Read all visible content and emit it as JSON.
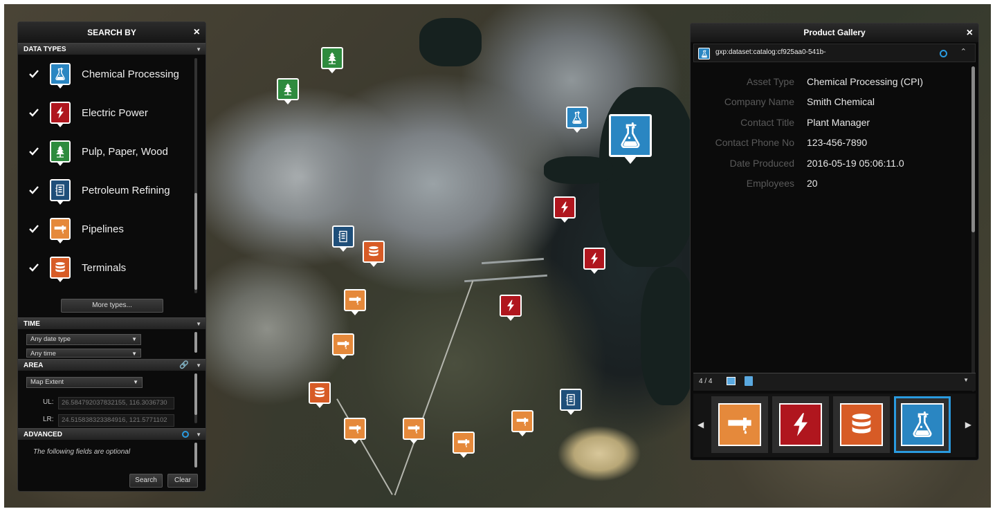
{
  "search_panel": {
    "title": "SEARCH BY",
    "close": "×",
    "data_types_header": "DATA TYPES",
    "data_types": [
      {
        "label": "Chemical Processing",
        "icon": "flask-icon",
        "color": "#2a86c2",
        "checked": true
      },
      {
        "label": "Electric Power",
        "icon": "lightning-icon",
        "color": "#b0161e",
        "checked": true
      },
      {
        "label": "Pulp, Paper, Wood",
        "icon": "tree-icon",
        "color": "#2e8b3e",
        "checked": true
      },
      {
        "label": "Petroleum Refining",
        "icon": "refinery-icon",
        "color": "#1f4f7a",
        "checked": true
      },
      {
        "label": "Pipelines",
        "icon": "pipeline-icon",
        "color": "#e5893b",
        "checked": true
      },
      {
        "label": "Terminals",
        "icon": "tank-icon",
        "color": "#d75b26",
        "checked": true
      }
    ],
    "more_types": "More types...",
    "time_header": "TIME",
    "date_type": "Any date type",
    "time_value": "Any time",
    "area_header": "AREA",
    "area_mode": "Map Extent",
    "ul_label": "UL:",
    "ul_value": "26.584792037832155, 116.3036730",
    "lr_label": "LR:",
    "lr_value": "24.515838323384916, 121.5771102",
    "advanced_header": "ADVANCED",
    "advanced_note": "The following fields are optional",
    "search_button": "Search",
    "clear_button": "Clear"
  },
  "gallery": {
    "title": "Product Gallery",
    "close": "×",
    "dataset_id": "gxp:dataset:catalog:cf925aa0-541b-",
    "details": [
      {
        "key": "Asset Type",
        "value": "Chemical Processing (CPI)"
      },
      {
        "key": "Company Name",
        "value": "Smith Chemical"
      },
      {
        "key": "Contact Title",
        "value": "Plant Manager"
      },
      {
        "key": "Contact Phone No",
        "value": "123-456-7890"
      },
      {
        "key": "Date Produced",
        "value": "2016-05-19 05:06:11.0"
      },
      {
        "key": "Employees",
        "value": "20"
      }
    ],
    "page_count": "4 / 4",
    "thumbnails": [
      {
        "icon": "pipeline-icon",
        "color": "#e5893b"
      },
      {
        "icon": "lightning-icon",
        "color": "#b0161e"
      },
      {
        "icon": "tank-icon",
        "color": "#d75b26"
      },
      {
        "icon": "flask-icon",
        "color": "#2a86c2",
        "active": true
      }
    ]
  },
  "map_markers": [
    {
      "type": "tree-icon",
      "color": "#2e8b3e"
    },
    {
      "type": "tree-icon",
      "color": "#2e8b3e"
    },
    {
      "type": "flask-icon",
      "color": "#2a86c2"
    },
    {
      "type": "flask-icon",
      "color": "#2a86c2",
      "selected": true
    },
    {
      "type": "lightning-icon",
      "color": "#b0161e"
    },
    {
      "type": "lightning-icon",
      "color": "#b0161e"
    },
    {
      "type": "lightning-icon",
      "color": "#b0161e"
    },
    {
      "type": "refinery-icon",
      "color": "#1f4f7a"
    },
    {
      "type": "refinery-icon",
      "color": "#1f4f7a"
    },
    {
      "type": "tank-icon",
      "color": "#d75b26"
    },
    {
      "type": "tank-icon",
      "color": "#d75b26"
    },
    {
      "type": "pipeline-icon",
      "color": "#e5893b"
    },
    {
      "type": "pipeline-icon",
      "color": "#e5893b"
    },
    {
      "type": "pipeline-icon",
      "color": "#e5893b"
    },
    {
      "type": "pipeline-icon",
      "color": "#e5893b"
    },
    {
      "type": "pipeline-icon",
      "color": "#e5893b"
    },
    {
      "type": "pipeline-icon",
      "color": "#e5893b"
    }
  ]
}
